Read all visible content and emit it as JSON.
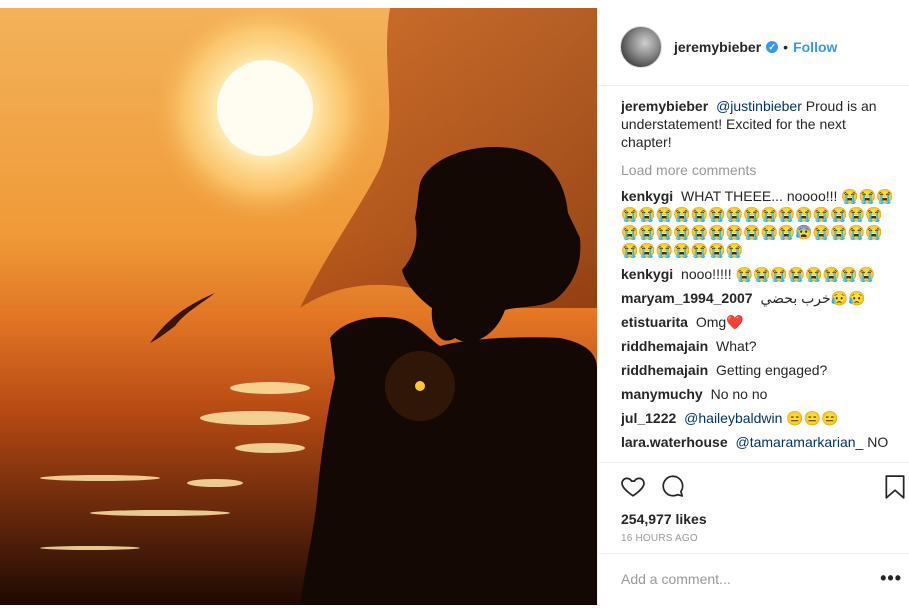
{
  "post": {
    "username": "jeremybieber",
    "verified": true,
    "follow_label": "Follow",
    "separator": "•"
  },
  "caption": {
    "username": "jeremybieber",
    "mention": "@justinbieber",
    "text": "Proud is an understatement! Excited for the next chapter!"
  },
  "load_more_label": "Load more comments",
  "comments": [
    {
      "username": "kenkygi",
      "text": "WHAT THEEE... noooo!!! 😭😭😭😭😭😭😭😭😭😭😭😭😭😭😭😭😭😭😭😭😭😭😭😭😭😭😭😭😰😭😭😭😭😭😭😭😭😭😭😭"
    },
    {
      "username": "kenkygi",
      "text": "nooo!!!!! 😭😭😭😭😭😭😭😭"
    },
    {
      "username": "maryam_1994_2007",
      "text": "خرب بحضي😥😥"
    },
    {
      "username": "etistuarita",
      "text": "Omg❤️"
    },
    {
      "username": "riddhemajain",
      "text": "What?"
    },
    {
      "username": "riddhemajain",
      "text": "Getting engaged?"
    },
    {
      "username": "manymuchy",
      "text": "No no no"
    },
    {
      "username": "jul_1222",
      "mention": "@haileybaldwin",
      "text": "😑😑😑"
    },
    {
      "username": "lara.waterhouse",
      "mention": "@tamaramarkarian_",
      "text": "NO"
    }
  ],
  "likes": "254,977 likes",
  "timestamp": "16 HOURS AGO",
  "add_comment_placeholder": "Add a comment...",
  "more_label": "•••",
  "icons": {
    "like": "heart-icon",
    "comment": "comment-bubble-icon",
    "save": "bookmark-icon",
    "verified": "verified-badge-icon"
  },
  "colors": {
    "accent": "#3897f0",
    "mention": "#003569",
    "muted": "#999999",
    "text": "#262626"
  }
}
